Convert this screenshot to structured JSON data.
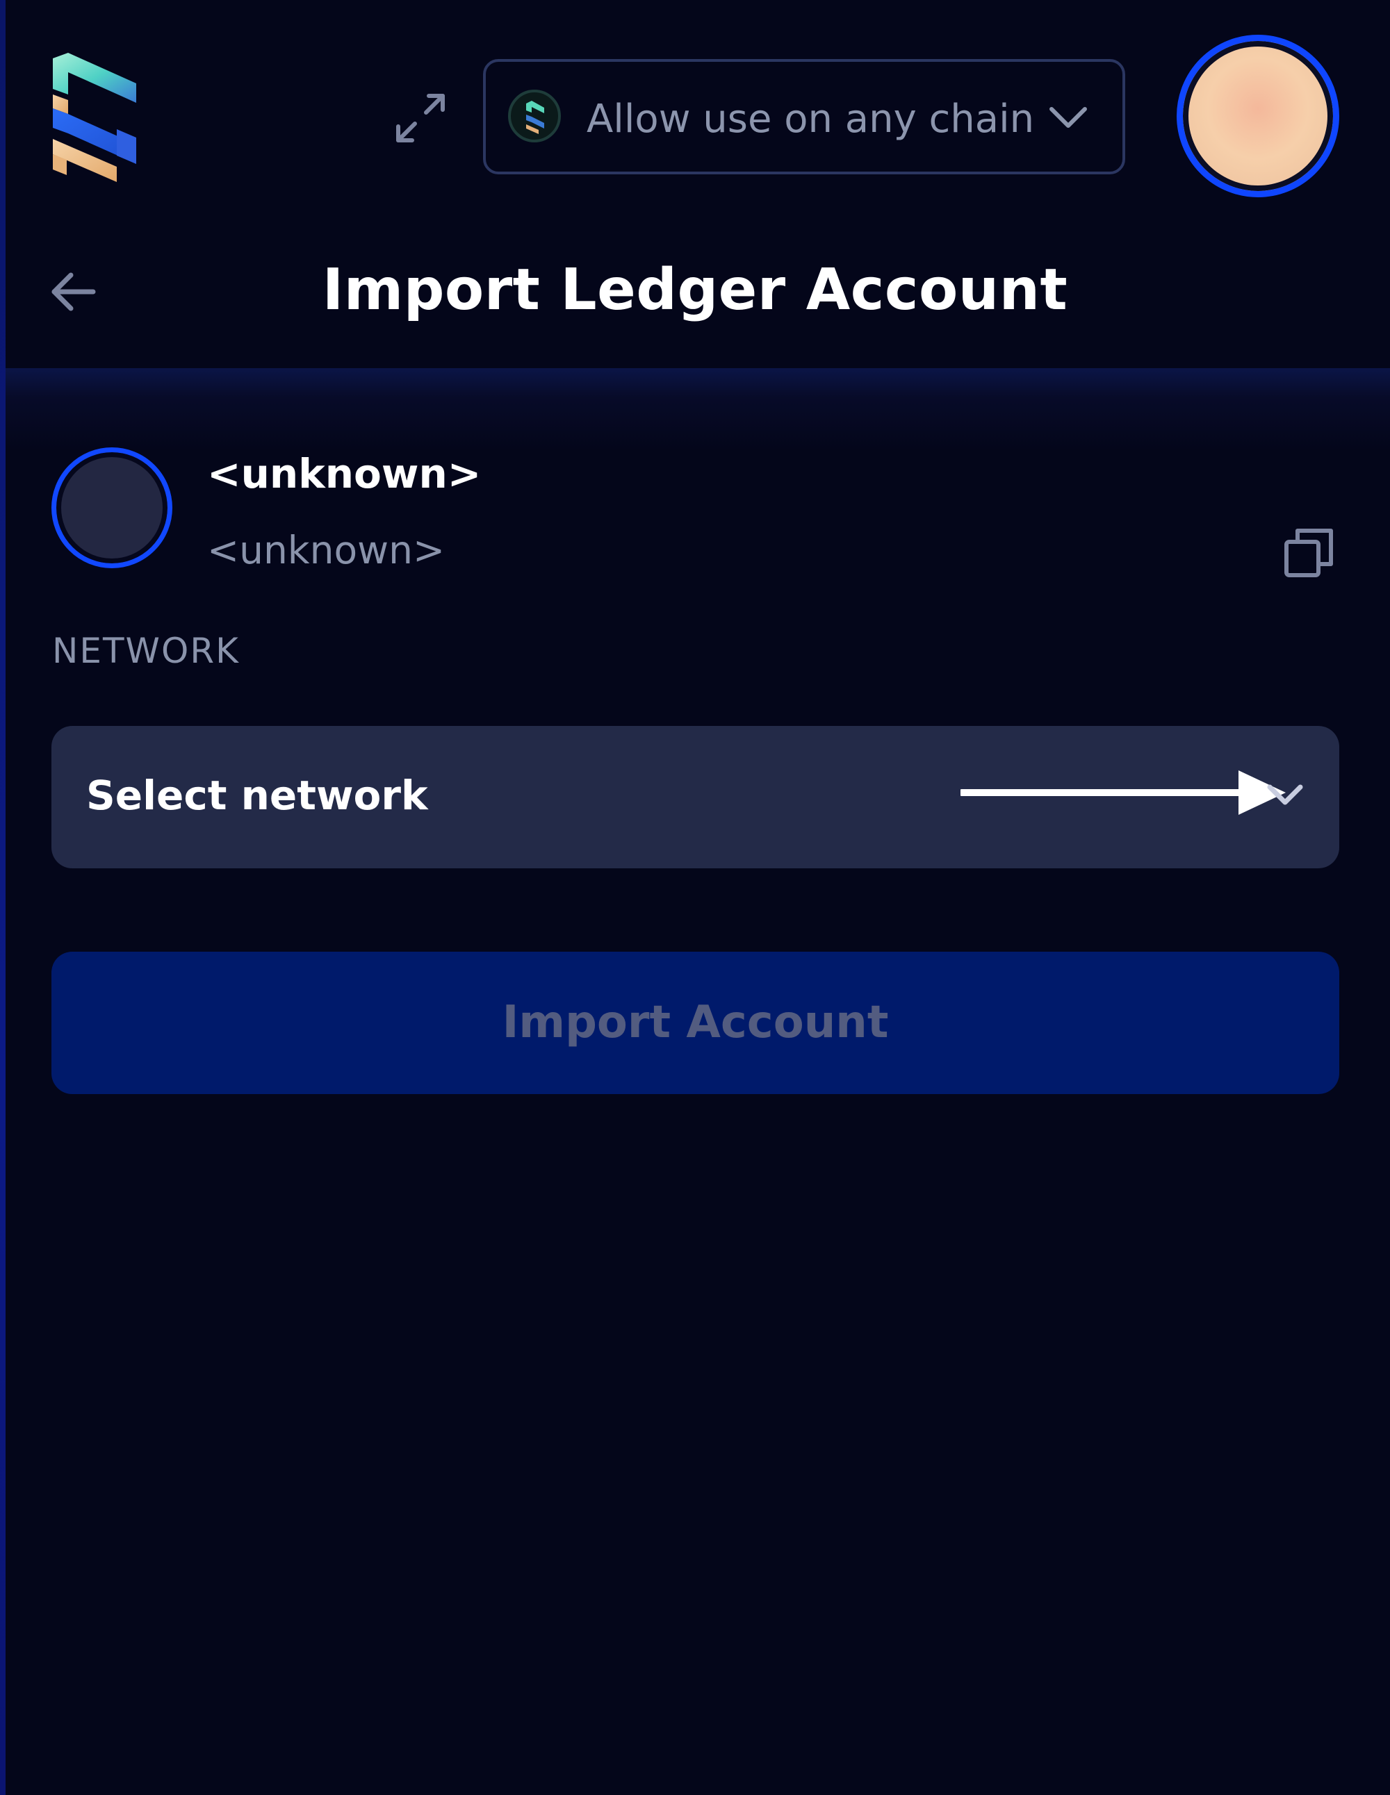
{
  "header": {
    "chain_selector_label": "Allow use on any chain"
  },
  "page": {
    "title": "Import Ledger Account"
  },
  "account": {
    "name": "<unknown>",
    "address": "<unknown>"
  },
  "network": {
    "section_label": "NETWORK",
    "select_placeholder": "Select network"
  },
  "actions": {
    "import_label": "Import Account"
  },
  "icons": {
    "logo": "subwallet-logo",
    "expand": "expand-icon",
    "chain": "chain-icon",
    "chevron": "chevron-down-icon",
    "back": "arrow-left-icon",
    "copy": "copy-icon",
    "annotation": "arrow-right-icon"
  },
  "colors": {
    "background": "#04061a",
    "accent_blue": "#0f46ff",
    "input_background": "#232a48",
    "button_disabled": "#001a6b",
    "muted_text": "#8a93ab"
  }
}
